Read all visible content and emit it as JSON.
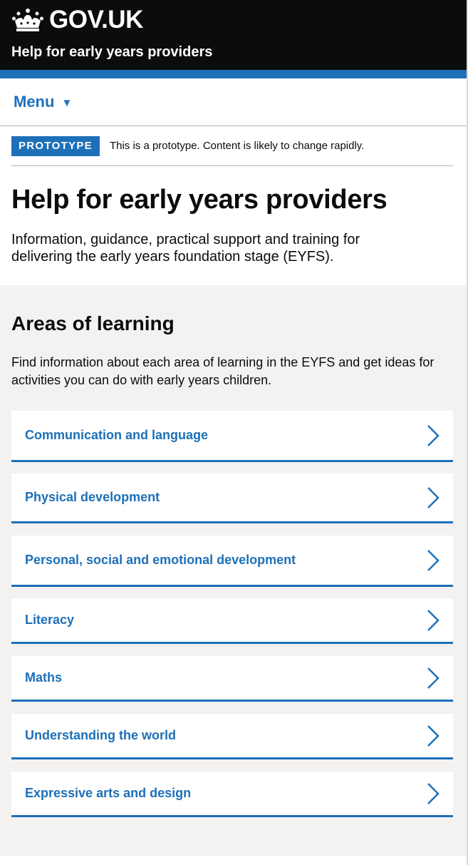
{
  "header": {
    "logo_text": "GOV.UK",
    "service_name": "Help for early years providers",
    "brand_color": "#1d70b8",
    "bar_color": "#0b0c0c"
  },
  "menu": {
    "label": "Menu",
    "arrow": "▼"
  },
  "phase_banner": {
    "tag": "PROTOTYPE",
    "text": "This is a prototype. Content is likely to change rapidly."
  },
  "hero": {
    "title": "Help for early years providers",
    "description": "Information, guidance, practical support and training for delivering the early years foundation stage (EYFS)."
  },
  "areas": {
    "title": "Areas of learning",
    "description": "Find information about each area of learning in the EYFS and get ideas for activities you can do with early years children.",
    "items": [
      {
        "label": "Communication and language",
        "icon": "chevron-right-icon"
      },
      {
        "label": "Physical development",
        "icon": "chevron-right-icon"
      },
      {
        "label": "Personal, social and emotional development",
        "icon": "chevron-right-icon"
      },
      {
        "label": "Literacy",
        "icon": "chevron-right-icon"
      },
      {
        "label": "Maths",
        "icon": "chevron-right-icon"
      },
      {
        "label": "Understanding the world",
        "icon": "chevron-right-icon"
      },
      {
        "label": "Expressive arts and design",
        "icon": "chevron-right-icon"
      }
    ]
  }
}
